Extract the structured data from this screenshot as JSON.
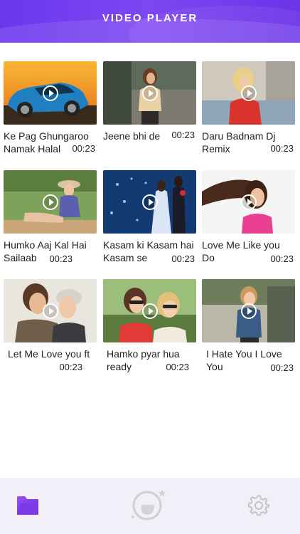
{
  "header": {
    "title": "VIDEO PLAYER"
  },
  "videos": [
    {
      "title": "Ke Pag Ghungaroo Namak Halal",
      "duration": "00:23",
      "thumbnail": "car-sunset"
    },
    {
      "title": "Jeene bhi de",
      "duration": "00:23",
      "thumbnail": "woman-on-stairs"
    },
    {
      "title": "Daru Badnam Dj Remix",
      "duration": "00:23",
      "thumbnail": "blonde-woman-red-dress"
    },
    {
      "title": "Humko Aaj Kal Hai Sailaab",
      "duration": "00:23",
      "thumbnail": "woman-with-hat"
    },
    {
      "title": "Kasam ki Kasam hai Kasam se",
      "duration": "00:23",
      "thumbnail": "couple-in-rain"
    },
    {
      "title": "Love Me Like you Do",
      "duration": "00:23",
      "thumbnail": "woman-hair-blowing"
    },
    {
      "title": "Let Me Love you ft",
      "duration": "00:23",
      "thumbnail": "couple-embracing"
    },
    {
      "title": "Hamko pyar hua ready",
      "duration": "00:23",
      "thumbnail": "two-women-sunglasses"
    },
    {
      "title": "I Hate You I Love You",
      "duration": "00:23",
      "thumbnail": "woman-denim-jacket"
    }
  ],
  "tabbar": {
    "items": [
      {
        "icon": "folder-icon",
        "active": true
      },
      {
        "icon": "player-icon",
        "active": false
      },
      {
        "icon": "gear-icon",
        "active": false
      }
    ]
  },
  "colors": {
    "accent": "#7b42f0",
    "header_start": "#6a38ee",
    "header_end": "#6c33e8",
    "tabbar_bg": "#f2eff8"
  }
}
